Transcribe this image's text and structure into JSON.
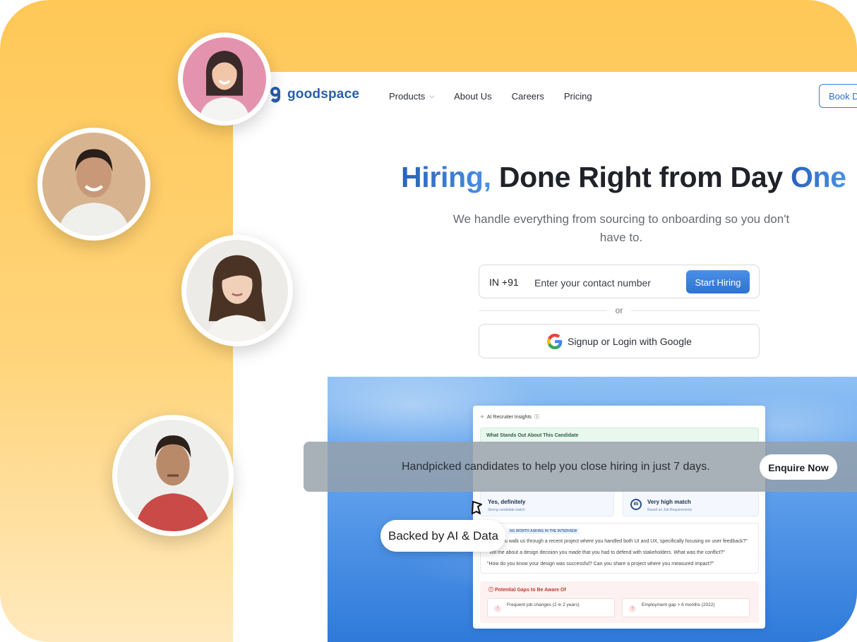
{
  "brand": {
    "name": "goodspace",
    "color": "#2a5ea8",
    "accent": "#3f7fd8"
  },
  "nav": {
    "items": [
      {
        "label": "Products",
        "has_dropdown": true
      },
      {
        "label": "About Us"
      },
      {
        "label": "Careers"
      },
      {
        "label": "Pricing"
      }
    ],
    "cta": "Book De"
  },
  "hero": {
    "title_part1": "Hiring,",
    "title_part2": " Done Right from Day ",
    "title_part3": "One",
    "subtitle": "We handle everything from sourcing to onboarding so you don't have to."
  },
  "signup": {
    "country_code": "IN +91",
    "phone_placeholder": "Enter your contact number",
    "start_button": "Start Hiring",
    "divider": "or",
    "google_button": "Signup or Login with Google"
  },
  "insights_card": {
    "header": "AI Recruiter Insights",
    "stand_out": "What Stands Out About This Candidate",
    "recommend_title": "Yes, definitely",
    "recommend_sub": "Strong candidate match",
    "match_score": "85",
    "match_title": "Very high match",
    "match_sub": "Based on Job Requirements",
    "questions_tag": "NG WORTH ASKING IN THE INTERVIEW",
    "questions": [
      "u walk us through a recent project where you handled both UI and UX, specifically focusing on user feedback?\"",
      "\"Tell me about a design decision you made that you had to defend with stakeholders. What was the conflict?\"",
      "\"How do you know your design was successful? Can you share a project where you measured impact?\""
    ],
    "gaps_title": "Potential Gaps to Be Aware Of",
    "gaps": [
      "Frequent job changes (2 in 2 years)",
      "Employment gap > 6 months (2022)"
    ]
  },
  "banner": {
    "text": "Handpicked candidates to help you close hiring in just 7 days.",
    "button": "Enquire Now"
  },
  "badge": {
    "text": "Backed by AI & Data"
  }
}
